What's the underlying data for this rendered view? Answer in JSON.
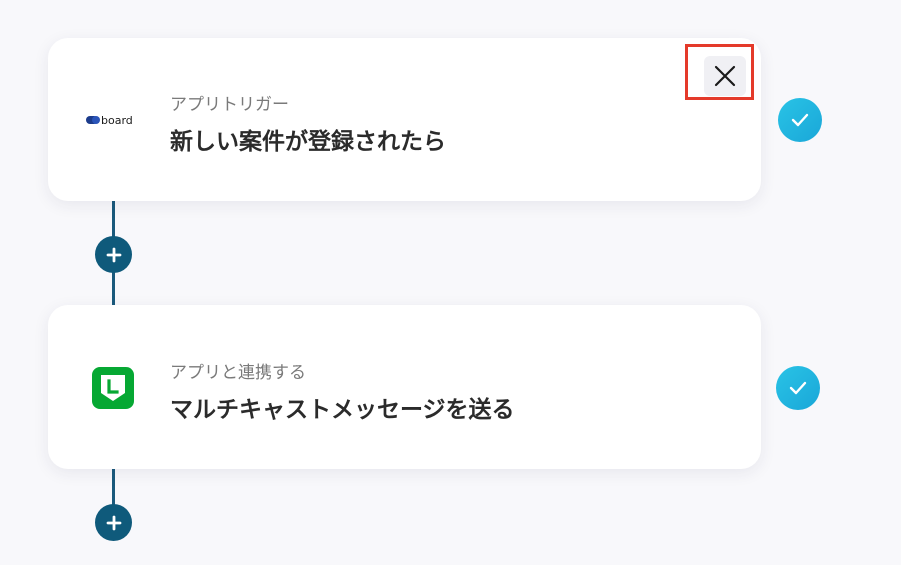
{
  "flow": {
    "steps": [
      {
        "app_name": "board",
        "subtitle": "アプリトリガー",
        "title": "新しい案件が登録されたら",
        "logo_icon": "board-logo-icon",
        "close_icon": "close-icon",
        "status_icon": "check-icon",
        "accent_color": "#2b2b2b"
      },
      {
        "app_name": "LINE",
        "subtitle": "アプリと連携する",
        "title": "マルチキャストメッセージを送る",
        "logo_icon": "line-logo-icon",
        "status_icon": "check-icon",
        "accent_color": "#06a833"
      }
    ],
    "add_button_icon": "plus-icon"
  },
  "colors": {
    "connector": "#1a5a7c",
    "plus_button": "#0f5a7b",
    "check_badge": "#1fb4df",
    "highlight": "#e43a2a"
  }
}
